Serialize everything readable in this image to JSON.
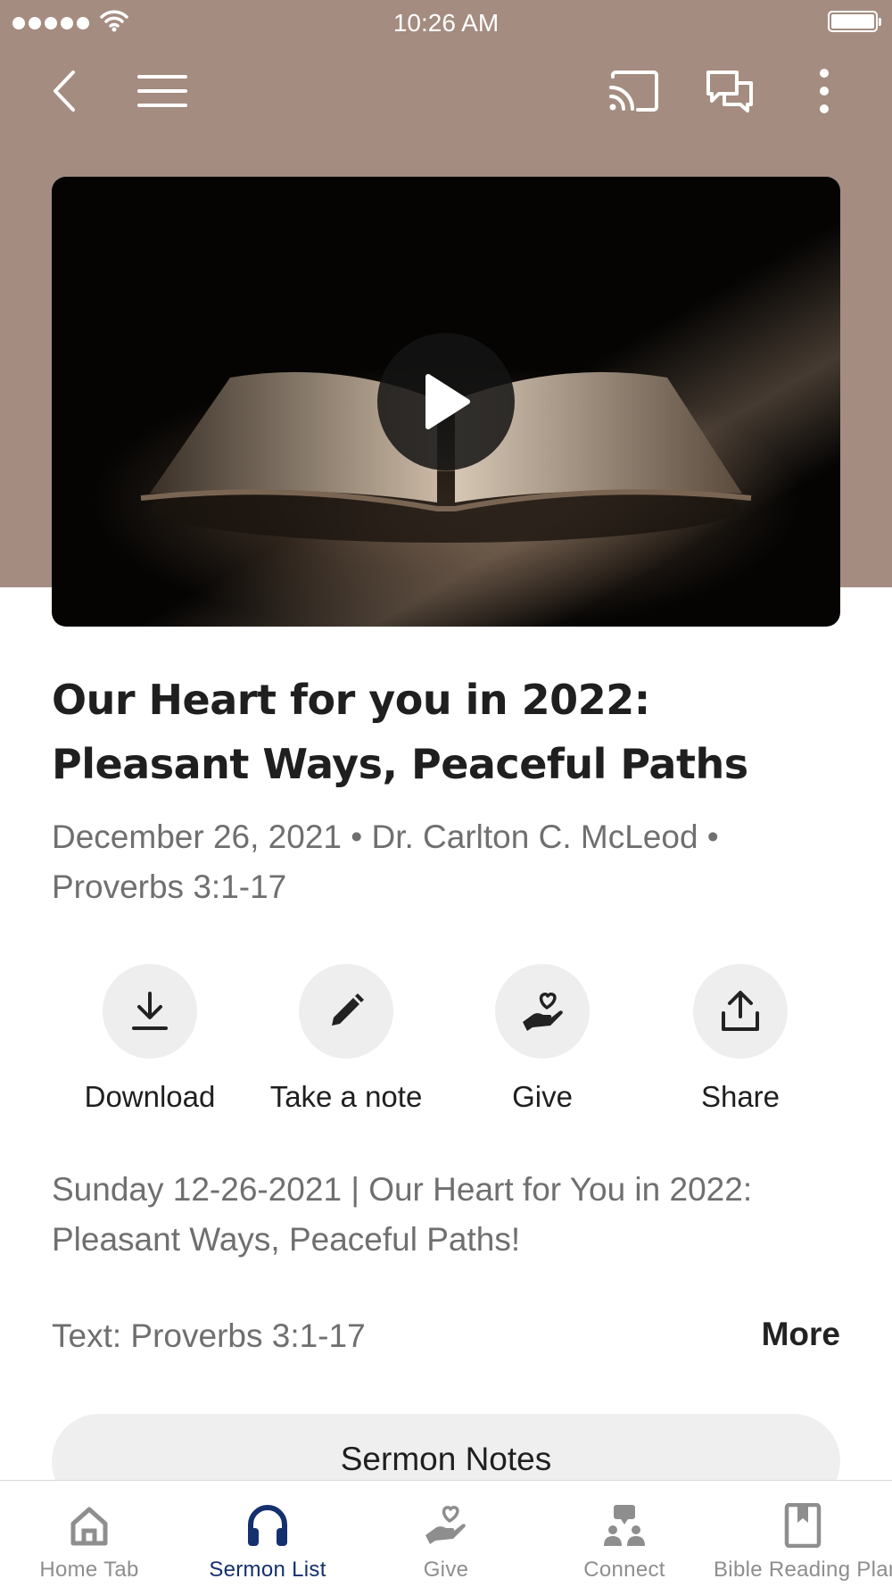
{
  "status_bar": {
    "time": "10:26 AM"
  },
  "nav": {
    "icons": [
      "back-icon",
      "menu-icon",
      "cast-icon",
      "chat-icon",
      "more-vertical-icon"
    ]
  },
  "video": {
    "play_icon": "play-icon"
  },
  "sermon": {
    "title_line1": "Our Heart for you in 2022:",
    "title_line2": "Pleasant Ways, Peaceful Paths",
    "meta_line1": "December 26, 2021 • Dr. Carlton C. McLeod •",
    "meta_line2": "Proverbs 3:1-17",
    "description_line1": "Sunday 12-26-2021 | Our Heart for You in 2022:",
    "description_line2": "Pleasant Ways, Peaceful Paths!",
    "text_ref": "Text: Proverbs 3:1-17",
    "more_label": "More"
  },
  "actions": [
    {
      "label": "Download",
      "icon": "download-icon"
    },
    {
      "label": "Take a note",
      "icon": "pencil-icon"
    },
    {
      "label": "Give",
      "icon": "give-heart-icon"
    },
    {
      "label": "Share",
      "icon": "share-icon"
    }
  ],
  "sermon_notes_label": "Sermon Notes",
  "tab_bar": {
    "active_color": "#14306e",
    "inactive_color": "#8e8e8e",
    "tabs": [
      {
        "label": "Home Tab",
        "icon": "home-icon",
        "active": false
      },
      {
        "label": "Sermon List",
        "icon": "headphones-icon",
        "active": true
      },
      {
        "label": "Give",
        "icon": "give-heart-icon",
        "active": false
      },
      {
        "label": "Connect",
        "icon": "connect-people-icon",
        "active": false
      },
      {
        "label": "Bible Reading Plan",
        "icon": "bookmark-book-icon",
        "active": false
      }
    ]
  },
  "colors": {
    "header_background": "#a48c80"
  }
}
